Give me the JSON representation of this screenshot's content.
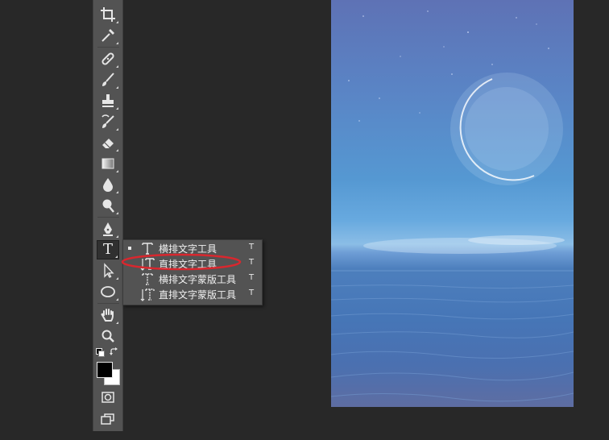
{
  "toolbar": {
    "tools": [
      {
        "name": "crop-tool",
        "icon": "crop-icon"
      },
      {
        "name": "eyedropper-tool",
        "icon": "eyedropper-icon"
      },
      {
        "name": "healing-brush-tool",
        "icon": "bandage-icon"
      },
      {
        "name": "brush-tool",
        "icon": "brush-icon"
      },
      {
        "name": "clone-stamp-tool",
        "icon": "stamp-icon"
      },
      {
        "name": "history-brush-tool",
        "icon": "history-brush-icon"
      },
      {
        "name": "eraser-tool",
        "icon": "eraser-icon"
      },
      {
        "name": "gradient-tool",
        "icon": "gradient-icon"
      },
      {
        "name": "blur-tool",
        "icon": "drop-icon"
      },
      {
        "name": "dodge-tool",
        "icon": "dodge-icon"
      },
      {
        "name": "pen-tool",
        "icon": "pen-icon"
      },
      {
        "name": "type-tool",
        "icon": "type-icon",
        "label": "T",
        "active": true
      },
      {
        "name": "path-selection-tool",
        "icon": "arrow-icon"
      },
      {
        "name": "ellipse-tool",
        "icon": "ellipse-icon"
      },
      {
        "name": "hand-tool",
        "icon": "hand-icon"
      },
      {
        "name": "zoom-tool",
        "icon": "magnifier-icon"
      }
    ],
    "foreground_color": "#000000",
    "background_color": "#ffffff"
  },
  "type_flyout": {
    "items": [
      {
        "label": "横排文字工具",
        "shortcut": "T",
        "icon": "horizontal-type-icon",
        "selected": true
      },
      {
        "label": "直排文字工具",
        "shortcut": "T",
        "icon": "vertical-type-icon",
        "circled": true
      },
      {
        "label": "横排文字蒙版工具",
        "shortcut": "T",
        "icon": "horizontal-type-mask-icon"
      },
      {
        "label": "直排文字蒙版工具",
        "shortcut": "T",
        "icon": "vertical-type-mask-icon"
      }
    ],
    "circle_color": "#d9272e"
  },
  "canvas": {
    "description_colors": {
      "sky": "#5a84c5",
      "sea": "#4676b7",
      "moon": "#e4f1fb"
    }
  }
}
